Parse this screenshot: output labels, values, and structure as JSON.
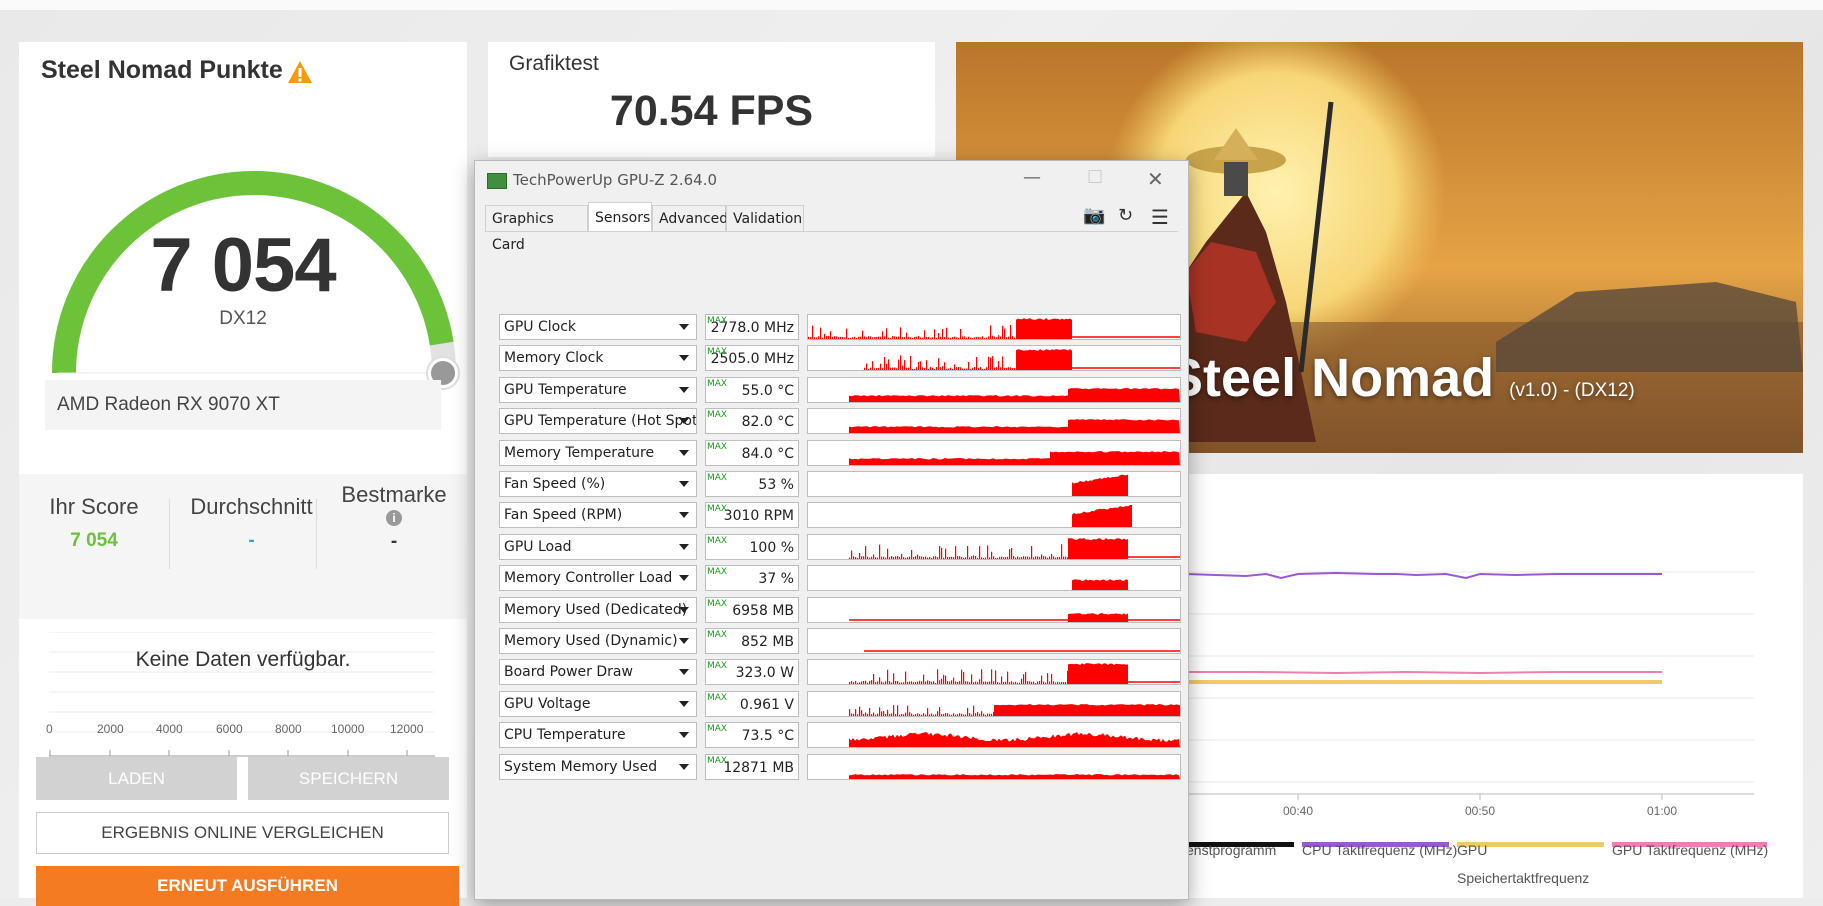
{
  "score_card": {
    "title": "Steel Nomad Punkte",
    "score": "7 054",
    "api": "DX12",
    "gpu_name": "AMD Radeon RX 9070 XT",
    "gauge_fill": 0.95,
    "your_score_label": "Ihr Score",
    "your_score_value": "7 054",
    "average_label": "Durchschnitt",
    "average_value": "-",
    "best_label": "Bestmarke",
    "best_value": "-",
    "no_data": "Keine Daten verfügbar.",
    "axis_ticks": [
      "0",
      "2000",
      "4000",
      "6000",
      "8000",
      "10000",
      "12000"
    ],
    "load_button": "LADEN",
    "save_button": "SPEICHERN",
    "compare_button": "ERGEBNIS ONLINE VERGLEICHEN",
    "rerun_button": "ERNEUT AUSFÜHREN"
  },
  "graphics_test": {
    "label": "Grafiktest",
    "fps": "70.54 FPS"
  },
  "hero": {
    "title": "Steel Nomad",
    "subtitle": "(v1.0) - (DX12)"
  },
  "monitoring": {
    "time_ticks": [
      "00:40",
      "00:50",
      "01:00"
    ],
    "legend": [
      {
        "label": "enstprogramm",
        "color": "#111111"
      },
      {
        "label": "CPU Taktfrequenz (MHz)",
        "color": "#9b59d0"
      },
      {
        "label": "GPU Speichertaktfrequenz",
        "color": "#f0c96a"
      },
      {
        "label": "GPU Taktfrequenz (MHz)",
        "color": "#ee7fb5"
      }
    ]
  },
  "gpuz": {
    "title": "TechPowerUp GPU-Z 2.64.0",
    "tabs": [
      "Graphics Card",
      "Sensors",
      "Advanced",
      "Validation"
    ],
    "active_tab": "Sensors",
    "max_tag": "MAX",
    "sensors": [
      {
        "name": "GPU Clock",
        "value": "2778.0 MHz"
      },
      {
        "name": "Memory Clock",
        "value": "2505.0 MHz"
      },
      {
        "name": "GPU Temperature",
        "value": "55.0 °C"
      },
      {
        "name": "GPU Temperature (Hot Spot)",
        "value": "82.0 °C"
      },
      {
        "name": "Memory Temperature",
        "value": "84.0 °C"
      },
      {
        "name": "Fan Speed (%)",
        "value": "53 %"
      },
      {
        "name": "Fan Speed (RPM)",
        "value": "3010 RPM"
      },
      {
        "name": "GPU Load",
        "value": "100 %"
      },
      {
        "name": "Memory Controller Load",
        "value": "37 %"
      },
      {
        "name": "Memory Used (Dedicated)",
        "value": "6958 MB"
      },
      {
        "name": "Memory Used (Dynamic)",
        "value": "852 MB"
      },
      {
        "name": "Board Power Draw",
        "value": "323.0 W"
      },
      {
        "name": "GPU Voltage",
        "value": "0.961 V"
      },
      {
        "name": "CPU Temperature",
        "value": "73.5 °C"
      },
      {
        "name": "System Memory Used",
        "value": "12871 MB"
      }
    ]
  },
  "colors": {
    "accent_orange": "#f47b22",
    "gauge_green": "#6cc33a",
    "score_green": "#6cc33a",
    "sensor_red": "#ff0000"
  }
}
